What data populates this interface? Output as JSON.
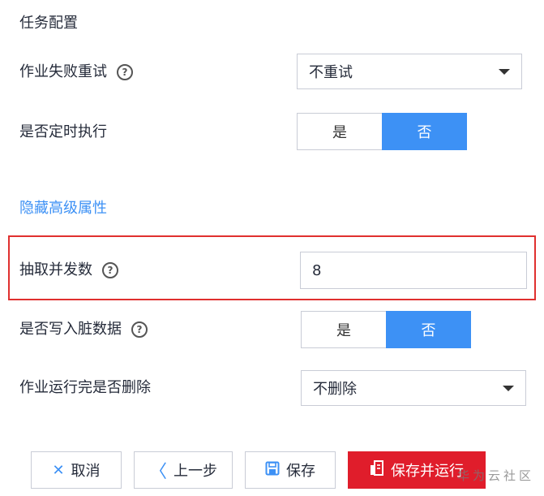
{
  "section_title": "任务配置",
  "retry": {
    "label": "作业失败重试",
    "value": "不重试"
  },
  "schedule": {
    "label": "是否定时执行",
    "yes": "是",
    "no": "否"
  },
  "advanced_link": "隐藏高级属性",
  "concurrency": {
    "label": "抽取并发数",
    "value": "8"
  },
  "dirty_data": {
    "label": "是否写入脏数据",
    "yes": "是",
    "no": "否"
  },
  "delete_after": {
    "label": "作业运行完是否删除",
    "value": "不删除"
  },
  "buttons": {
    "cancel": "取消",
    "prev": "上一步",
    "save": "保存",
    "save_run": "保存并运行"
  },
  "watermark": "华为云社区",
  "colors": {
    "accent": "#3d91f5",
    "primary_button": "#e01d2b",
    "highlight_border": "#e0302f"
  },
  "icons": [
    "help-icon",
    "dropdown-caret-icon",
    "close-icon",
    "chevron-left-icon",
    "save-icon",
    "run-icon"
  ]
}
